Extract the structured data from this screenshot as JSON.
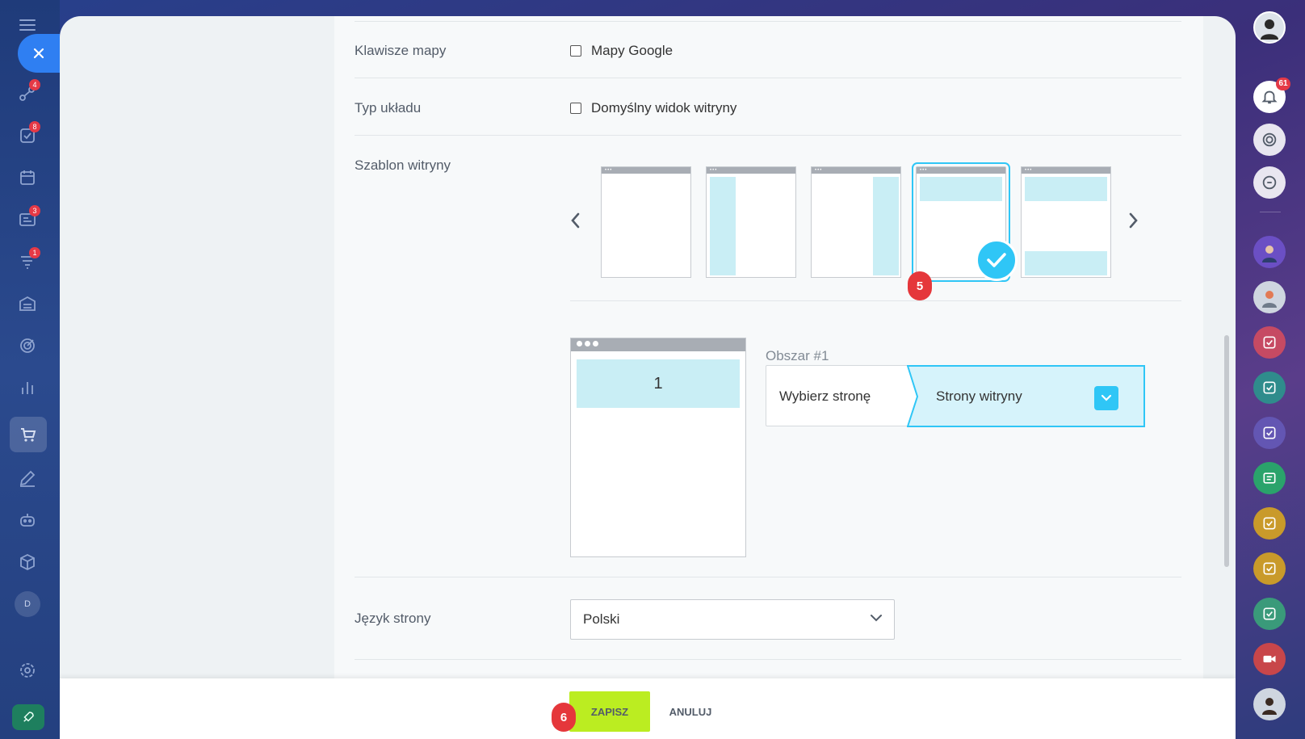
{
  "left_sidebar": {
    "badges": {
      "crm": "4",
      "tasks": "8",
      "feed": "3",
      "funnel": "1"
    },
    "profile_initial": "D"
  },
  "right_sidebar": {
    "notifications_badge": "61"
  },
  "form": {
    "map_keys": {
      "label": "Klawisze mapy",
      "option": "Mapy Google"
    },
    "layout_type": {
      "label": "Typ układu",
      "option": "Domyślny widok witryny"
    },
    "site_template": {
      "label": "Szablon witryny",
      "selected_index": 3
    },
    "step_badge_template": "5",
    "preview": {
      "area_number": "1"
    },
    "area": {
      "title": "Obszar #1",
      "left_text": "Wybierz stronę",
      "right_text": "Strony witryny"
    },
    "language": {
      "label": "Język strony",
      "value": "Polski"
    }
  },
  "footer": {
    "save_label": "ZAPISZ",
    "cancel_label": "ANULUJ",
    "step_badge": "6"
  },
  "colors": {
    "accent": "#2fc6f6",
    "save": "#bbed21",
    "badge": "#e5373b",
    "template_block": "#c9eef5"
  }
}
